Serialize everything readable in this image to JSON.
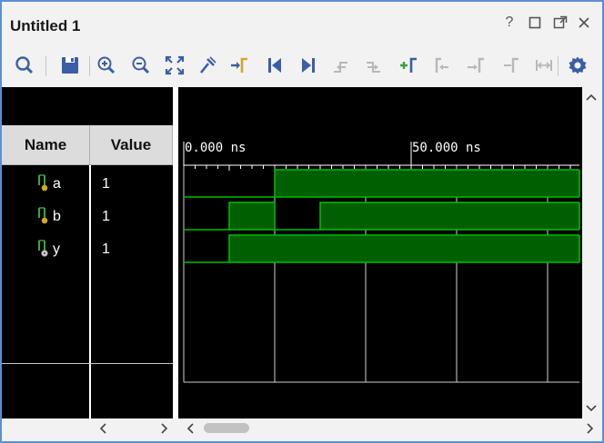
{
  "window": {
    "title": "Untitled 1"
  },
  "columns": {
    "name": "Name",
    "value": "Value"
  },
  "signals": [
    {
      "name": "a",
      "value": "1",
      "type": "input"
    },
    {
      "name": "b",
      "value": "1",
      "type": "input"
    },
    {
      "name": "y",
      "value": "1",
      "type": "output"
    }
  ],
  "timeline": {
    "labels": [
      {
        "text": "0.000 ns",
        "time_ns": 0
      },
      {
        "text": "50.000 ns",
        "time_ns": 50
      }
    ],
    "range_ns": [
      0,
      87
    ]
  },
  "waveforms": {
    "a": [
      [
        0,
        0
      ],
      [
        20,
        1
      ]
    ],
    "b": [
      [
        0,
        0
      ],
      [
        10,
        1
      ],
      [
        20,
        0
      ],
      [
        30,
        1
      ]
    ],
    "y": [
      [
        0,
        0
      ],
      [
        10,
        1
      ]
    ]
  },
  "colors": {
    "wave": "#00c000",
    "wave_fill": "#005f00",
    "grid": "#ffffff",
    "accent": "#3a5ea8",
    "yellow": "#d9a520"
  }
}
